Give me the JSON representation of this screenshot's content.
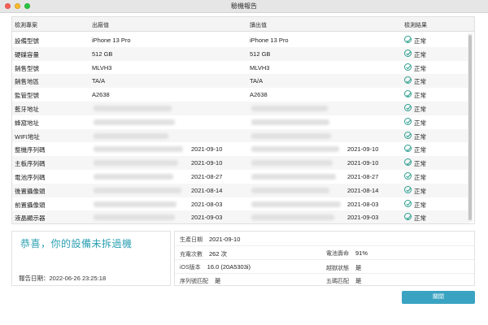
{
  "window": {
    "title": "驗機報告"
  },
  "table": {
    "headers": {
      "item": "檢測專案",
      "factory": "出廠值",
      "read": "讀出值",
      "result": "檢測結果"
    },
    "rows": [
      {
        "item": "設備型號",
        "factory": "iPhone 13 Pro",
        "factory_date": "",
        "read": "iPhone 13 Pro",
        "read_date": "",
        "result": "正常",
        "blurred": false
      },
      {
        "item": "硬碟容量",
        "factory": "512 GB",
        "factory_date": "",
        "read": "512 GB",
        "read_date": "",
        "result": "正常",
        "blurred": false
      },
      {
        "item": "銷售型號",
        "factory": "MLVH3",
        "factory_date": "",
        "read": "MLVH3",
        "read_date": "",
        "result": "正常",
        "blurred": false
      },
      {
        "item": "銷售地區",
        "factory": "TA/A",
        "factory_date": "",
        "read": "TA/A",
        "read_date": "",
        "result": "正常",
        "blurred": false
      },
      {
        "item": "監管型號",
        "factory": "A2638",
        "factory_date": "",
        "read": "A2638",
        "read_date": "",
        "result": "正常",
        "blurred": false
      },
      {
        "item": "藍牙地址",
        "factory": "",
        "factory_date": "",
        "read": "",
        "read_date": "",
        "result": "正常",
        "blurred": true
      },
      {
        "item": "蜂窩地址",
        "factory": "",
        "factory_date": "",
        "read": "",
        "read_date": "",
        "result": "正常",
        "blurred": true
      },
      {
        "item": "WIFI地址",
        "factory": "",
        "factory_date": "",
        "read": "",
        "read_date": "",
        "result": "正常",
        "blurred": true
      },
      {
        "item": "整機序列碼",
        "factory": "",
        "factory_date": "2021-09-10",
        "read": "",
        "read_date": "2021-09-10",
        "result": "正常",
        "blurred": true
      },
      {
        "item": "主板序列碼",
        "factory": "",
        "factory_date": "2021-09-10",
        "read": "",
        "read_date": "2021-09-10",
        "result": "正常",
        "blurred": true
      },
      {
        "item": "電池序列碼",
        "factory": "",
        "factory_date": "2021-08-27",
        "read": "",
        "read_date": "2021-08-27",
        "result": "正常",
        "blurred": true
      },
      {
        "item": "後置攝像頭",
        "factory": "",
        "factory_date": "2021-08-14",
        "read": "",
        "read_date": "2021-08-14",
        "result": "正常",
        "blurred": true
      },
      {
        "item": "前置攝像頭",
        "factory": "",
        "factory_date": "2021-08-03",
        "read": "",
        "read_date": "2021-08-03",
        "result": "正常",
        "blurred": true
      },
      {
        "item": "液晶顯示器",
        "factory": "",
        "factory_date": "2021-09-03",
        "read": "",
        "read_date": "2021-09-03",
        "result": "正常",
        "blurred": true
      }
    ]
  },
  "summary": {
    "message": "恭喜，你的設備未拆過機",
    "report_date_label": "報告日期：",
    "report_date": "2022-06-26 23:25:18"
  },
  "details": {
    "production_date_label": "生產日期",
    "production_date": "2021-09-10",
    "charge_count_label": "充電次數",
    "charge_count": "262 次",
    "battery_life_label": "電池壽命",
    "battery_life": "91%",
    "ios_label": "iOS版本",
    "ios_version": "16.0 (20A5303i)",
    "jailbreak_label": "越獄狀態",
    "jailbreak": "是",
    "serial_match_label": "序列號匹配",
    "serial_match": "是",
    "activation_label": "五碼匹配",
    "activation": "是"
  },
  "actions": {
    "close_label": "關閉"
  },
  "colors": {
    "accent": "#2b9fb1",
    "check": "#2a9e8f",
    "button": "#3aa3c2"
  }
}
